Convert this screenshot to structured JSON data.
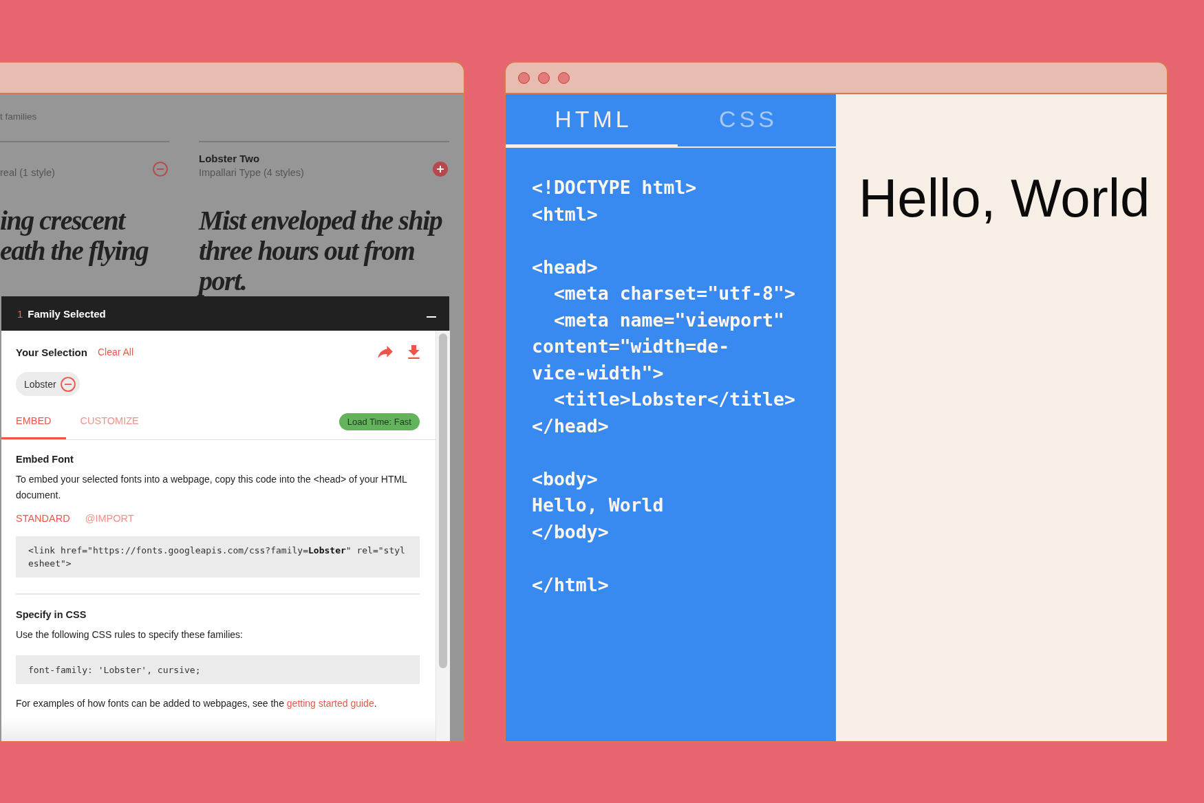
{
  "font_browser": {
    "heading": "t families",
    "font_cards": [
      {
        "subtitle": "real (1 style)",
        "selected": true,
        "sample_lines": [
          "ing crescent",
          "eath the flying"
        ]
      },
      {
        "name": "Lobster Two",
        "subtitle": "Impallari Type (4 styles)",
        "selected": false,
        "sample": "Mist enveloped the ship three hours out from port."
      }
    ]
  },
  "selection_drawer": {
    "count": "1",
    "title": "Family Selected",
    "selection_label": "Your Selection",
    "clear_link": "Clear All",
    "chips": [
      {
        "label": "Lobster"
      }
    ],
    "tabs": [
      {
        "label": "EMBED",
        "selected": true
      },
      {
        "label": "CUSTOMIZE",
        "selected": false
      }
    ],
    "load_time_badge": "Load Time: Fast",
    "embed_section": {
      "title": "Embed Font",
      "description": "To embed your selected fonts into a webpage, copy this code into the <head> of your HTML document.",
      "methods": [
        {
          "label": "STANDARD",
          "selected": true
        },
        {
          "label": "@IMPORT",
          "selected": false
        }
      ],
      "code": "<link href=\"https://fonts.googleapis.com/css?family=**Lobster**\" rel=\"stylesheet\">"
    },
    "css_section": {
      "title": "Specify in CSS",
      "description": "Use the following CSS rules to specify these families:",
      "code": "font-family: 'Lobster', cursive;"
    },
    "footer_note": {
      "text_before": "For examples of how fonts can be added to webpages, see the ",
      "link": "getting started guide",
      "text_after": "."
    }
  },
  "editor_window": {
    "tabs": [
      {
        "label": "HTML",
        "selected": true
      },
      {
        "label": "CSS",
        "selected": false
      }
    ],
    "code_blocks": [
      [
        "<!DOCTYPE html>",
        "<html>"
      ],
      [
        "<head>",
        "  <meta charset=\"utf-8\">",
        "  <meta name=\"viewport\"",
        "content=\"width=de-",
        "vice-width\">",
        "  <title>Lobster</title>",
        "</head>"
      ],
      [
        "<body>",
        "Hello, World",
        "</body>"
      ],
      [
        "</html>"
      ]
    ],
    "preview_heading": "Hello, World"
  }
}
